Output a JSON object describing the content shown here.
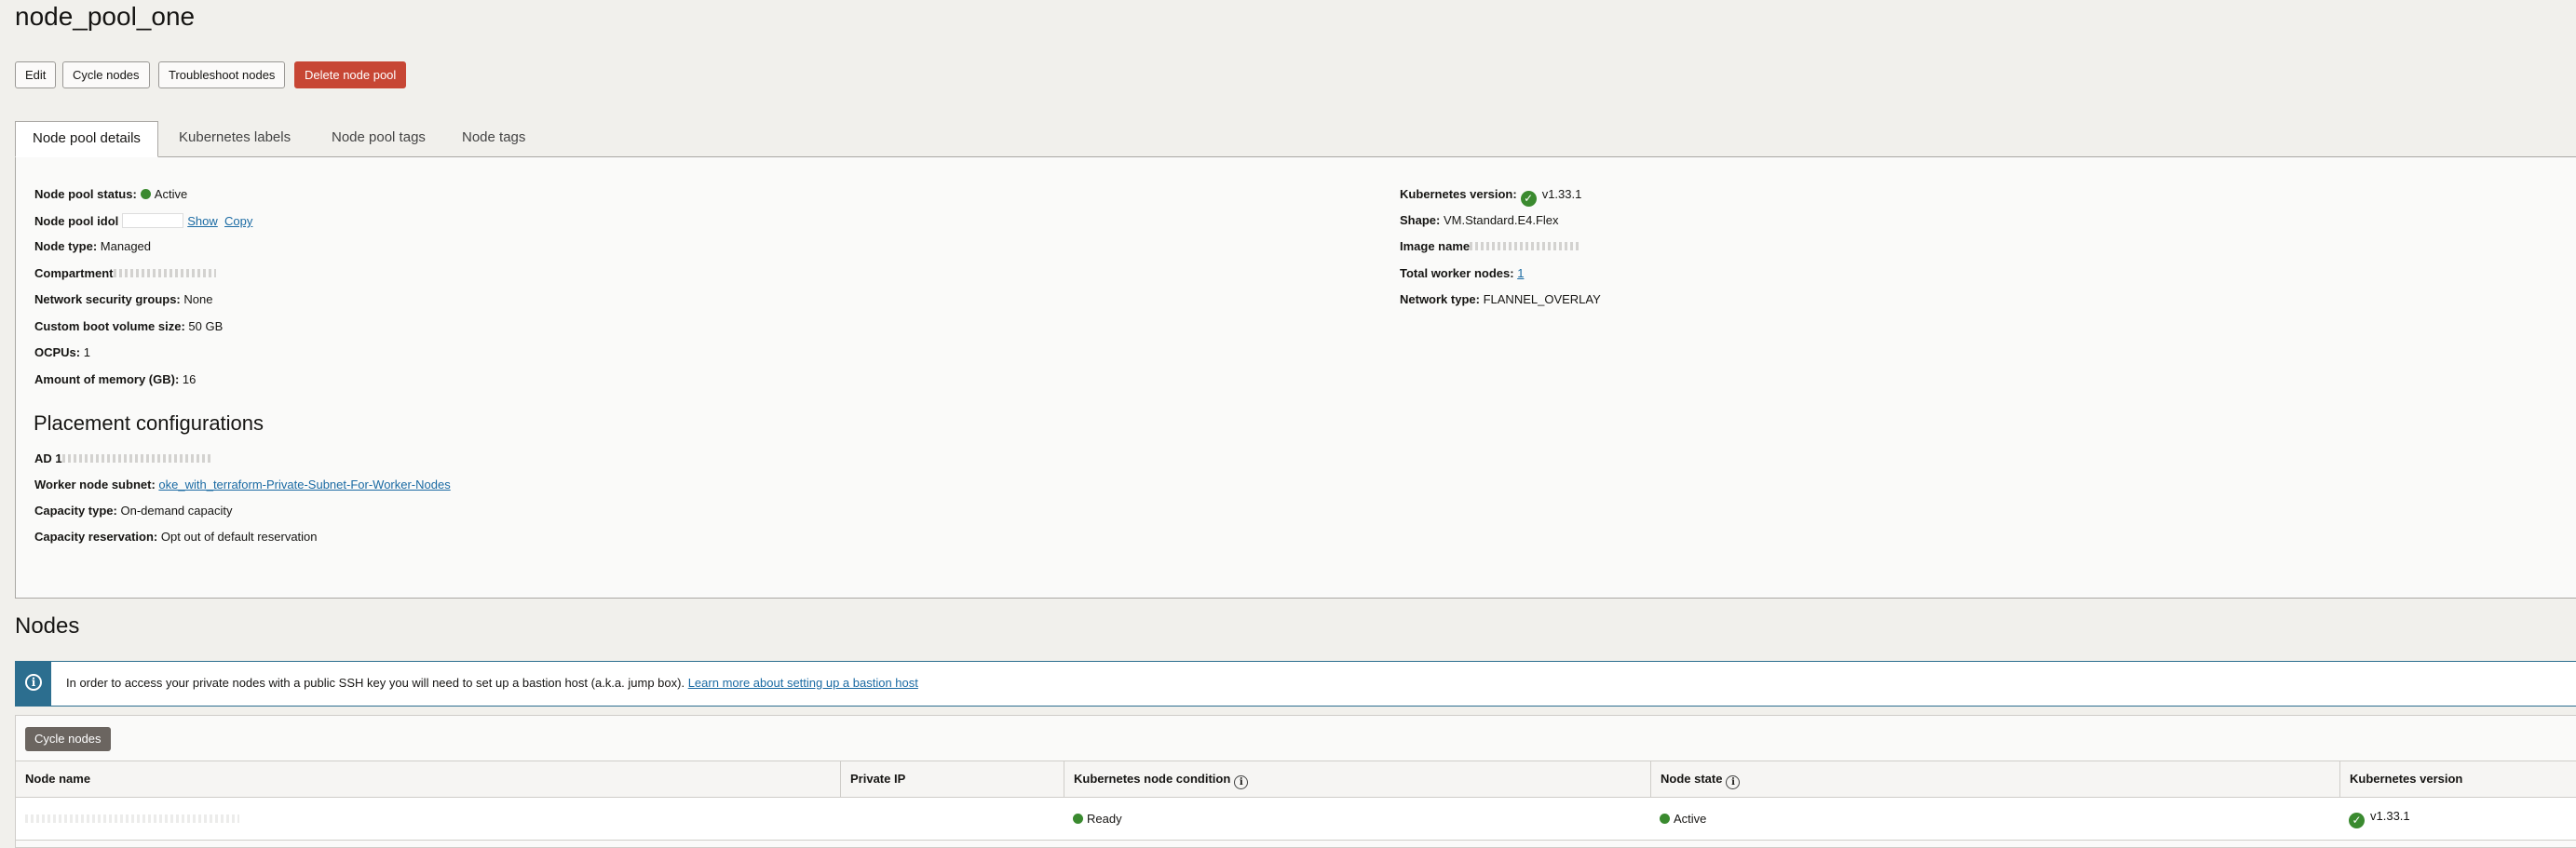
{
  "page": {
    "title": "node_pool_one"
  },
  "actions": {
    "edit": "Edit",
    "cycle_nodes": "Cycle nodes",
    "troubleshoot_nodes": "Troubleshoot nodes",
    "delete_node_pool": "Delete node pool"
  },
  "tabs": [
    "Node pool details",
    "Kubernetes labels",
    "Node pool tags",
    "Node tags"
  ],
  "details": {
    "left": {
      "status_label": "Node pool status:",
      "status_value": "Active",
      "ocid_label": "Node pool idol",
      "show_link": "Show",
      "copy_link": "Copy",
      "node_type_label": "Node type:",
      "node_type_value": "Managed",
      "compartment_label": "Compartment",
      "nsg_label": "Network security groups:",
      "nsg_value": "None",
      "boot_volume_label": "Custom boot volume size:",
      "boot_volume_value": "50 GB",
      "ocpus_label": "OCPUs:",
      "ocpus_value": "1",
      "memory_label": "Amount of memory (GB):",
      "memory_value": "16"
    },
    "right": {
      "k8s_version_label": "Kubernetes version:",
      "k8s_version_value": "v1.33.1",
      "shape_label": "Shape:",
      "shape_value": "VM.Standard.E4.Flex",
      "image_name_label": "Image name",
      "total_workers_label": "Total worker nodes:",
      "total_workers_value": "1",
      "network_type_label": "Network type:",
      "network_type_value": "FLANNEL_OVERLAY"
    }
  },
  "placement": {
    "title": "Placement configurations",
    "ad_label": "AD 1",
    "subnet_label": "Worker node subnet:",
    "subnet_value": "oke_with_terraform-Private-Subnet-For-Worker-Nodes",
    "capacity_type_label": "Capacity type:",
    "capacity_type_value": "On-demand capacity",
    "capacity_reservation_label": "Capacity reservation:",
    "capacity_reservation_value": "Opt out of default reservation"
  },
  "nodes": {
    "title": "Nodes",
    "banner_text": "In order to access your private nodes with a public SSH key you will need to set up a bastion host (a.k.a. jump box).",
    "banner_link": "Learn more about setting up a bastion host",
    "cycle_button": "Cycle nodes",
    "columns": [
      "Node name",
      "Private IP",
      "Kubernetes node condition",
      "Node state",
      "Kubernetes version"
    ],
    "rows": [
      {
        "name": "",
        "private_ip": "",
        "condition": "Ready",
        "state": "Active",
        "version": "v1.33.1"
      }
    ]
  },
  "colors": {
    "danger": "#c74634",
    "accent": "#2c6e8f",
    "status_green": "#3a8a2f",
    "link": "#1a6aa3"
  }
}
